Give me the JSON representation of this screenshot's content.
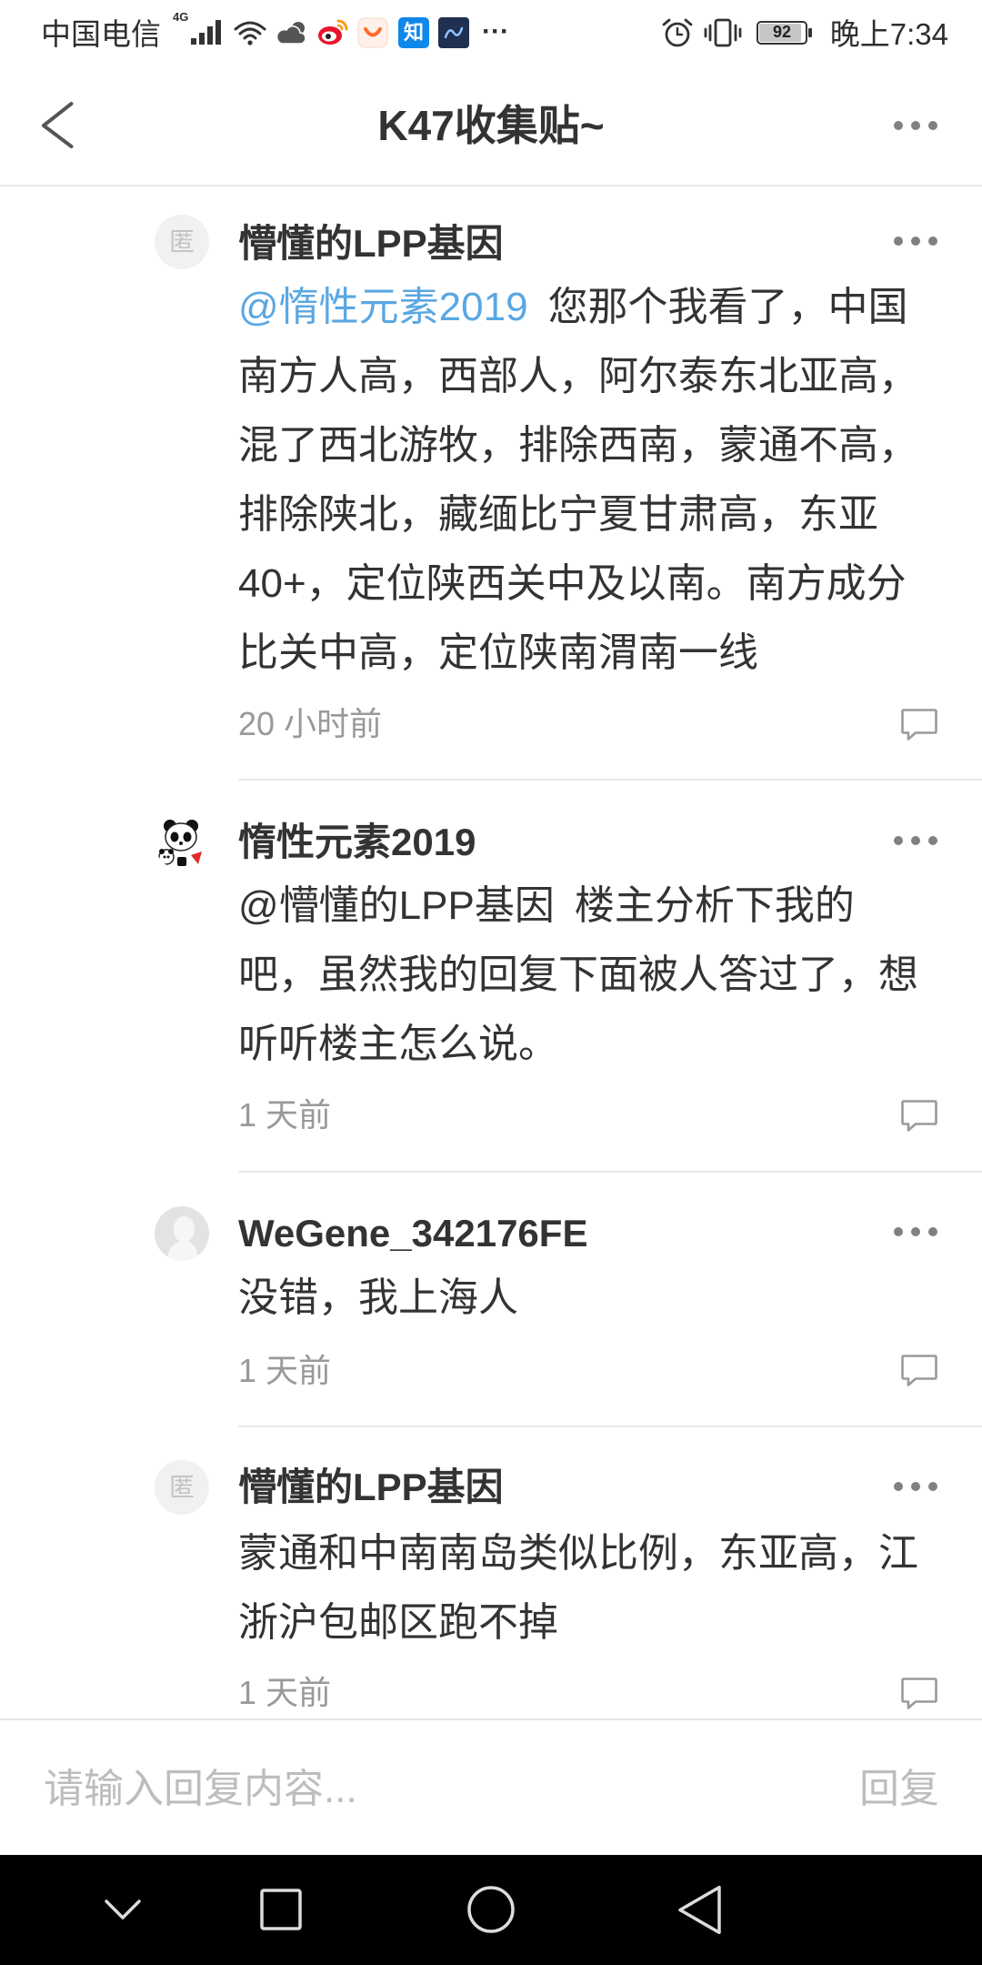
{
  "theme": {
    "text": "#333333",
    "mention": "#5aa7e2",
    "secondary": "#999999",
    "divider": "#e8e8e8",
    "placeholder": "#bdbdbd",
    "nav_background": "#000000"
  },
  "status_bar": {
    "carrier": "中国电信",
    "network_type": "4G",
    "zhihu_label": "知",
    "overflow": "···",
    "battery_level": "92",
    "time": "晚上7:34",
    "icons": [
      "signal-icon",
      "wifi-icon",
      "weather-icon",
      "weibo-icon",
      "app-icon",
      "zhihu-icon",
      "app-icon",
      "alarm-icon",
      "vibrate-icon",
      "battery-icon"
    ]
  },
  "header": {
    "title": "K47收集贴~",
    "left_icon": "chevron-left-icon",
    "right_icon": "more-icon"
  },
  "comments": [
    {
      "avatar": "anonymous-avatar",
      "avatar_text": "匿",
      "author": "懵懂的LPP基因",
      "mention": "@惰性元素2019",
      "lines": [
        "您那个我看了，中国",
        "南方人高，西部人，阿尔泰东北亚高，",
        "混了西北游牧，排除西南，蒙通不高，",
        "排除陕北，藏缅比宁夏甘肃高，东亚",
        "40+，定位陕西关中及以南。南方成分",
        "比关中高，定位陕南渭南一线"
      ],
      "time": "20 小时前"
    },
    {
      "avatar": "panda-avatar",
      "author": "惰性元素2019",
      "mention": "@懵懂的LPP基因",
      "lines": [
        "楼主分析下我的",
        "吧，虽然我的回复下面被人答过了，想",
        "听听楼主怎么说。"
      ],
      "time": "1 天前"
    },
    {
      "avatar": "default-avatar",
      "author": "WeGene_342176FE",
      "lines": [
        "没错，我上海人"
      ],
      "time": "1 天前"
    },
    {
      "avatar": "anonymous-avatar",
      "avatar_text": "匿",
      "author": "懵懂的LPP基因",
      "lines": [
        "蒙通和中南南岛类似比例，东亚高，江",
        "浙沪包邮区跑不掉"
      ],
      "time": "1 天前"
    }
  ],
  "reply_bar": {
    "placeholder": "请输入回复内容...",
    "submit_label": "回复"
  },
  "nav_bar": {
    "icons": [
      "chevron-down-icon",
      "square-icon",
      "circle-icon",
      "triangle-back-icon"
    ]
  }
}
